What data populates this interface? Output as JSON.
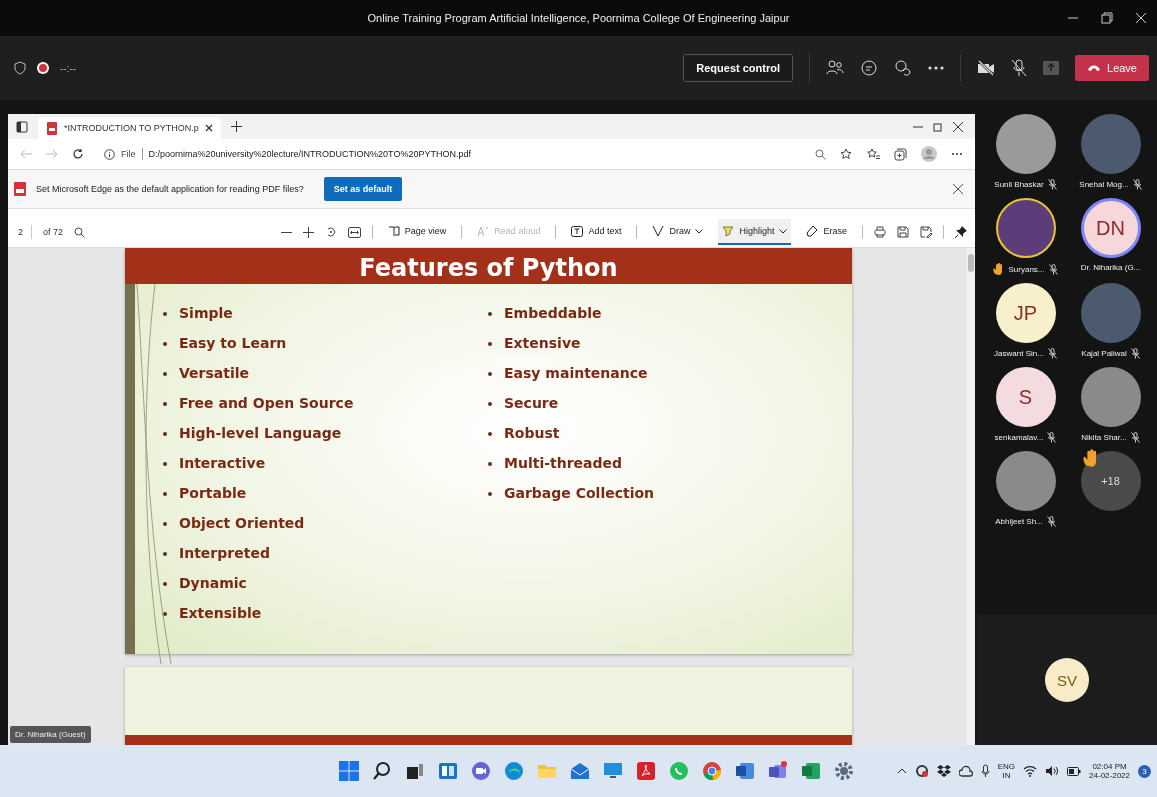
{
  "window": {
    "title": "Online Training Program Artificial Intelligence, Poornima College Of Engineering Jaipur"
  },
  "meeting_bar": {
    "recording": true,
    "timer": "--:--",
    "request_control": "Request control",
    "leave": "Leave"
  },
  "browser": {
    "tab": {
      "title": "*INTRODUCTION TO PYTHON.p",
      "selected": true
    },
    "address": {
      "scheme": "File",
      "url": "D:/poornima%20university%20lecture/INTRODUCTION%20TO%20PYTHON.pdf"
    },
    "infobar": {
      "message": "Set Microsoft Edge as the default application for reading PDF files?",
      "button": "Set as default"
    },
    "pdf_toolbar": {
      "page": "2",
      "page_count": "of 72",
      "tools": [
        {
          "label": "Page view",
          "disabled": false,
          "selected": false,
          "dropdown": false
        },
        {
          "label": "Read aloud",
          "disabled": true,
          "selected": false,
          "dropdown": false
        },
        {
          "label": "Add text",
          "disabled": false,
          "selected": false,
          "dropdown": false
        },
        {
          "label": "Draw",
          "disabled": false,
          "selected": false,
          "dropdown": true
        },
        {
          "label": "Highlight",
          "disabled": false,
          "selected": true,
          "dropdown": true
        },
        {
          "label": "Erase",
          "disabled": false,
          "selected": false,
          "dropdown": false
        }
      ]
    }
  },
  "slide": {
    "title": "Features of Python",
    "columns": [
      [
        "Simple",
        "Easy to Learn",
        "Versatile",
        "Free and Open Source",
        "High-level Language",
        "Interactive",
        "Portable",
        "Object Oriented",
        "Interpreted",
        "Dynamic",
        "Extensible"
      ],
      [
        "Embeddable",
        "Extensive",
        "Easy maintenance",
        "Secure",
        "Robust",
        "Multi-threaded",
        "Garbage Collection"
      ]
    ]
  },
  "presenter_label": "Dr. Niharika (Guest)",
  "participants": [
    {
      "name": "Sunil Bhaskar",
      "kind": "photo",
      "muted": true,
      "hand_raised": false,
      "speaking": false
    },
    {
      "name": "Snehal Mog...",
      "kind": "photo",
      "muted": true,
      "hand_raised": false,
      "speaking": false
    },
    {
      "name": "Suryans...",
      "kind": "photo",
      "muted": true,
      "hand_raised": true,
      "speaking": false
    },
    {
      "name": "Dr. Niharika (G...",
      "kind": "initials",
      "initials": "DN",
      "color": "#f6d8da",
      "muted": false,
      "hand_raised": false,
      "speaking": true
    },
    {
      "name": "Jaswant Sin...",
      "kind": "initials",
      "initials": "JP",
      "color": "#f8efcb",
      "muted": true,
      "hand_raised": false,
      "speaking": false
    },
    {
      "name": "Kajal Paliwal",
      "kind": "photo",
      "muted": true,
      "hand_raised": false,
      "speaking": false
    },
    {
      "name": "senkamalav...",
      "kind": "initials",
      "initials": "S",
      "color": "#f4dbe0",
      "muted": true,
      "hand_raised": false,
      "speaking": false
    },
    {
      "name": "Nikita Shar...",
      "kind": "blank",
      "muted": true,
      "hand_raised": false,
      "speaking": false
    },
    {
      "name": "Abhijeet Sh...",
      "kind": "blank",
      "muted": true,
      "hand_raised": false,
      "speaking": false
    }
  ],
  "overflow": {
    "count": "+18",
    "hand_raised": true
  },
  "self_view": {
    "initials": "SV",
    "color": "#f8ecc8"
  },
  "taskbar": {
    "language": "ENG",
    "region": "IN",
    "time": "02:04 PM",
    "date": "24-02-2022",
    "notifications": "3"
  }
}
